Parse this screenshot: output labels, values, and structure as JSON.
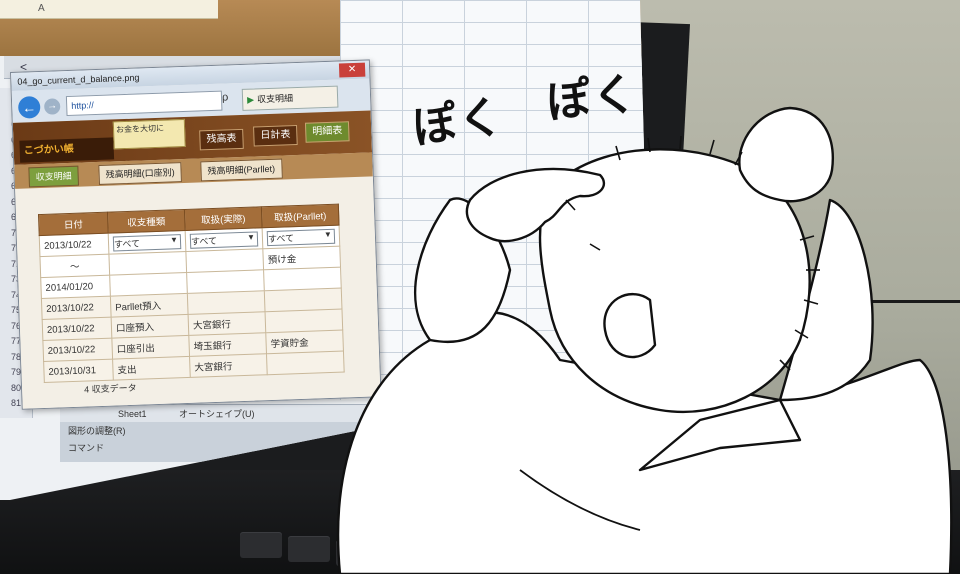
{
  "excel": {
    "col_header": "A",
    "rows": [
      "61",
      "62",
      "63",
      "64",
      "65",
      "66",
      "67",
      "68",
      "69",
      "70",
      "71",
      "72",
      "73",
      "74",
      "75",
      "76",
      "77",
      "78",
      "79",
      "80",
      "81"
    ],
    "sheet_tab": "Sheet1",
    "shape_menu": "オートシェイプ(U)",
    "status_line1": "図形の調整(R)",
    "status_line2": "コマンド"
  },
  "browser": {
    "title": "04_go_current_d_balance.png",
    "close": "✕",
    "back_glyph": "←",
    "forward_glyph": "→",
    "url": "http://",
    "search_glyph": "ρ",
    "tab_label": "収支明細",
    "logo": "こづかい帳",
    "mascot_text": "お金を大切に",
    "nav": [
      "残高表",
      "日計表",
      "明細表"
    ],
    "subnav": [
      "収支明細",
      "残高明細(口座別)",
      "残高明細(Parllet)"
    ],
    "table": {
      "headers": [
        "日付",
        "収支種類",
        "取扱(実際)",
        "取扱(Parllet)"
      ],
      "filter_date_from": "2013/10/22",
      "filter_sep": "〜",
      "filter_date_to": "2014/01/20",
      "filter_all": "すべて",
      "filter_extra": "預け金",
      "rows": [
        [
          "2013/10/22",
          "Parllet預入",
          "",
          ""
        ],
        [
          "2013/10/22",
          "口座預入",
          "大宮銀行",
          ""
        ],
        [
          "2013/10/22",
          "口座引出",
          "埼玉銀行",
          "学資貯金"
        ],
        [
          "2013/10/31",
          "支出",
          "大宮銀行",
          ""
        ]
      ],
      "count_label": "4 収支データ"
    }
  },
  "comic": {
    "sfx_left": "ぽく",
    "sfx_right": "ぽく"
  }
}
